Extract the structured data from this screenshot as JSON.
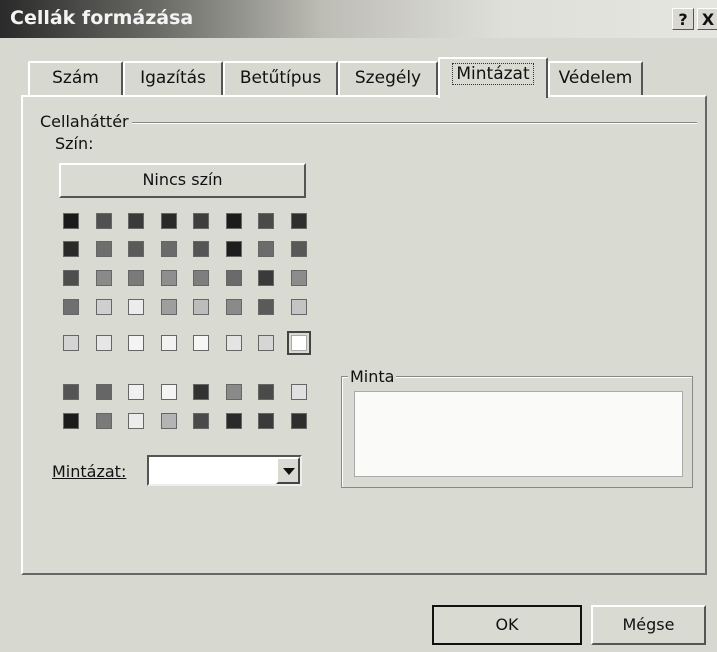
{
  "window": {
    "title": "Cellák formázása",
    "help": "?",
    "close": "X"
  },
  "tabs": [
    {
      "label": "Szám"
    },
    {
      "label": "Igazítás"
    },
    {
      "label": "Betűtípus"
    },
    {
      "label": "Szegély"
    },
    {
      "label": "Mintázat",
      "active": true
    },
    {
      "label": "Védelem"
    }
  ],
  "cell_background": {
    "group_label": "Cellaháttér",
    "color_label": "Szín:",
    "no_color_button": "Nincs szín",
    "palette_rows": [
      [
        "#1a1a1a",
        "#505050",
        "#3a3a3a",
        "#2a2a2a",
        "#3e3e3e",
        "#1c1c1c",
        "#4a4a4a",
        "#2e2e2e"
      ],
      [
        "#2a2a2a",
        "#6e6e6e",
        "#5a5a5a",
        "#6a6a6a",
        "#555555",
        "#1e1e1e",
        "#6c6c6c",
        "#585858"
      ],
      [
        "#4e4e4e",
        "#8a8a8a",
        "#7a7a7a",
        "#8e8e8e",
        "#7e7e7e",
        "#6a6a6a",
        "#3a3a3a",
        "#8c8c8c"
      ],
      [
        "#707070",
        "#cfcfcf",
        "#ececec",
        "#9e9e9e",
        "#bcbcbc",
        "#8a8a8a",
        "#5a5a5a",
        "#c4c4c4"
      ],
      [
        "#d4d4d4",
        "#e6e6e6",
        "#f4f4f4",
        "#f2f2f2",
        "#f6f6f6",
        "#e4e4e4",
        "#d6d6d6",
        "#ffffff"
      ],
      [
        "#555555",
        "#666666",
        "#f0f0f0",
        "#f4f4f4",
        "#333333",
        "#8a8a8a",
        "#4a4a4a",
        "#e0e0e0"
      ],
      [
        "#1c1c1c",
        "#7a7a7a",
        "#ececec",
        "#b4b4b4",
        "#4a4a4a",
        "#2a2a2a",
        "#3a3a3a",
        "#2e2e2e"
      ]
    ],
    "selected_swatch": {
      "row": 4,
      "col": 7
    }
  },
  "pattern": {
    "label": "Mintázat:",
    "value": ""
  },
  "sample": {
    "label": "Minta"
  },
  "buttons": {
    "ok": "OK",
    "cancel": "Mégse"
  }
}
